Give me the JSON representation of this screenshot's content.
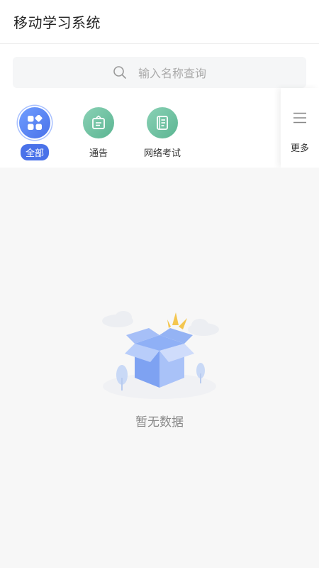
{
  "header": {
    "title": "移动学习系统"
  },
  "search": {
    "placeholder": "输入名称查询"
  },
  "categories": [
    {
      "label": "全部",
      "icon": "grid-apps-icon",
      "active": true
    },
    {
      "label": "通告",
      "icon": "notice-board-icon",
      "active": false
    },
    {
      "label": "网络考试",
      "icon": "exam-book-icon",
      "active": false
    }
  ],
  "more": {
    "label": "更多",
    "icon": "menu-lines-icon"
  },
  "empty": {
    "text": "暂无数据"
  },
  "colors": {
    "accent": "#4a72e9",
    "teal": "#5bb592"
  }
}
